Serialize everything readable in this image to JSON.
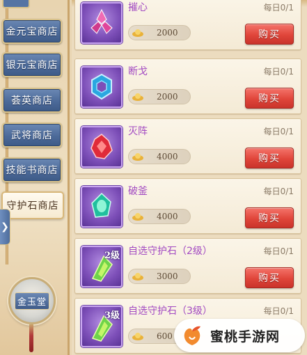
{
  "sidebar": {
    "tabs": [
      {
        "label": "金元宝商店",
        "active": false
      },
      {
        "label": "银元宝商店",
        "active": false
      },
      {
        "label": "荟英商店",
        "active": false
      },
      {
        "label": "武将商店",
        "active": false
      },
      {
        "label": "技能书商店",
        "active": false
      },
      {
        "label": "守护石商店",
        "active": true
      }
    ],
    "expand_icon": "chevron-right-icon",
    "hall_button": "金玉堂"
  },
  "items": [
    {
      "name": "摧心",
      "limit": "每日0/1",
      "price": "2000",
      "buy": "购买",
      "level": "",
      "gem": "pink-triple-crystal",
      "color": "#e0459a"
    },
    {
      "name": "断戈",
      "limit": "每日0/1",
      "price": "2000",
      "buy": "购买",
      "level": "",
      "gem": "blue-ring-crystal",
      "color": "#2aa7e0"
    },
    {
      "name": "灭阵",
      "limit": "每日0/1",
      "price": "4000",
      "buy": "购买",
      "level": "",
      "gem": "red-fire-crystal",
      "color": "#e02b3a"
    },
    {
      "name": "破釜",
      "limit": "每日0/1",
      "price": "4000",
      "buy": "购买",
      "level": "",
      "gem": "teal-leaf-crystal",
      "color": "#1fbf9e"
    },
    {
      "name": "自选守护石（2级）",
      "limit": "每日0/1",
      "price": "3000",
      "buy": "购买",
      "level": "2级",
      "gem": "green-selectable-crystal",
      "color": "#6fd34a"
    },
    {
      "name": "自选守护石（3级）",
      "limit": "每日0/1",
      "price": "600",
      "buy": "",
      "level": "3级",
      "gem": "green-selectable-crystal",
      "color": "#6fd34a"
    }
  ],
  "watermark": {
    "text": "蜜桃手游网"
  }
}
